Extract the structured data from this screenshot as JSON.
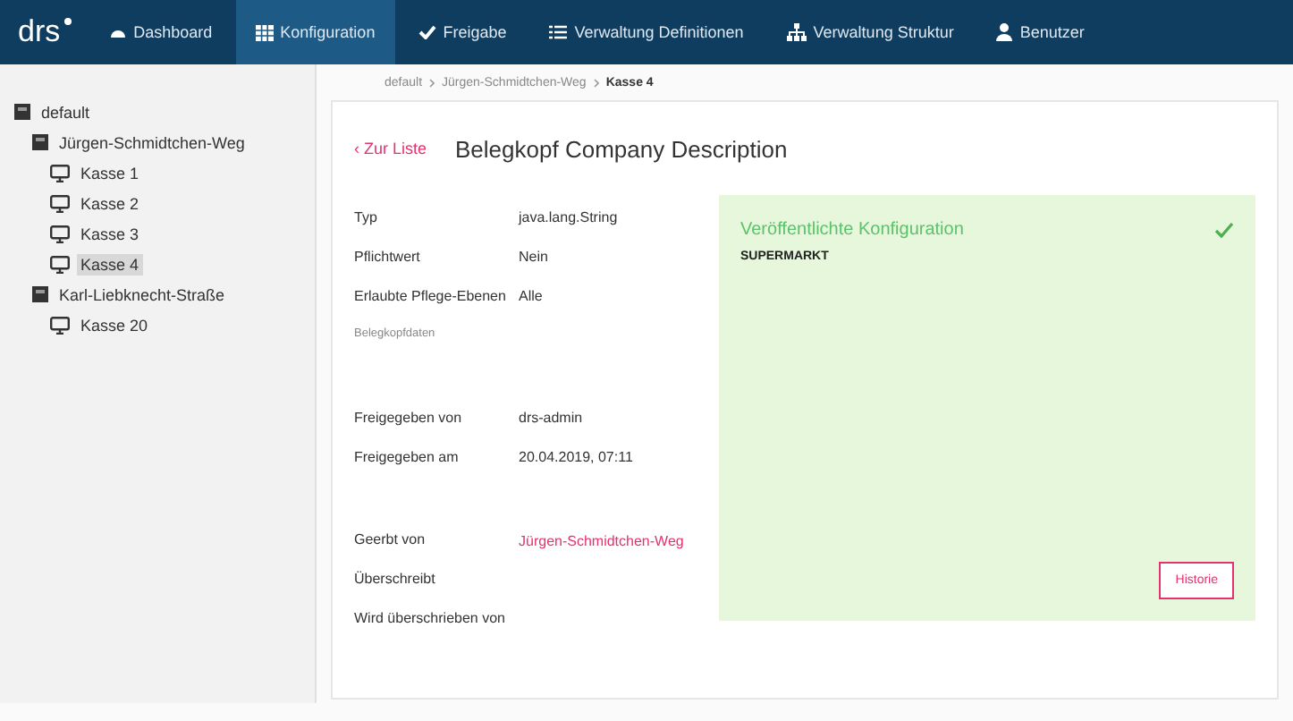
{
  "nav": {
    "logo": "drs",
    "items": [
      {
        "label": "Dashboard",
        "kind": "dashboard",
        "selected": false
      },
      {
        "label": "Konfiguration",
        "kind": "grid",
        "selected": true
      },
      {
        "label": "Freigabe",
        "kind": "check",
        "selected": false
      },
      {
        "label": "Verwaltung Definitionen",
        "kind": "list",
        "selected": false
      },
      {
        "label": "Verwaltung Struktur",
        "kind": "tree",
        "selected": false
      },
      {
        "label": "Benutzer",
        "kind": "user",
        "selected": false
      }
    ]
  },
  "sidebar": {
    "tree": [
      {
        "label": "default",
        "kind": "folder",
        "selected": false,
        "children": [
          {
            "label": "Jürgen-Schmidtchen-Weg",
            "kind": "folder",
            "selected": false,
            "children": [
              {
                "label": "Kasse 1",
                "kind": "register",
                "selected": false
              },
              {
                "label": "Kasse 2",
                "kind": "register",
                "selected": false
              },
              {
                "label": "Kasse 3",
                "kind": "register",
                "selected": false
              },
              {
                "label": "Kasse 4",
                "kind": "register",
                "selected": true
              }
            ]
          },
          {
            "label": "Karl-Liebknecht-Straße",
            "kind": "folder",
            "selected": false,
            "children": [
              {
                "label": "Kasse 20",
                "kind": "register",
                "selected": false
              }
            ]
          }
        ]
      }
    ]
  },
  "breadcrumb": [
    {
      "label": "default",
      "current": false
    },
    {
      "label": "Jürgen-Schmidtchen-Weg",
      "current": false
    },
    {
      "label": "Kasse 4",
      "current": true
    }
  ],
  "detail": {
    "back_link": "‹ Zur Liste",
    "title": "Belegkopf Company Description",
    "fields": [
      {
        "label": "Typ",
        "value": "java.lang.String",
        "kind": "text"
      },
      {
        "label": "Pflichtwert",
        "value": "Nein",
        "kind": "text"
      },
      {
        "label": "Erlaubte Pflege-Ebenen",
        "value": "Alle",
        "kind": "text"
      },
      {
        "label": "Belegkopfdaten",
        "kind": "note"
      },
      {
        "kind": "gap"
      },
      {
        "label": "Freigegeben von",
        "value": "drs-admin",
        "kind": "text"
      },
      {
        "label": "Freigegeben am",
        "value": "20.04.2019, 07:11",
        "kind": "text"
      },
      {
        "kind": "gap"
      },
      {
        "label": "Geerbt von",
        "value": "Jürgen-Schmidtchen-Weg",
        "kind": "link"
      },
      {
        "label": "Überschreibt",
        "kind": "text"
      },
      {
        "label": "Wird überschrieben von",
        "kind": "text"
      }
    ],
    "published": {
      "title": "Veröffentlichte Konfiguration",
      "value": "SUPERMARKT",
      "button": "Historie"
    }
  }
}
